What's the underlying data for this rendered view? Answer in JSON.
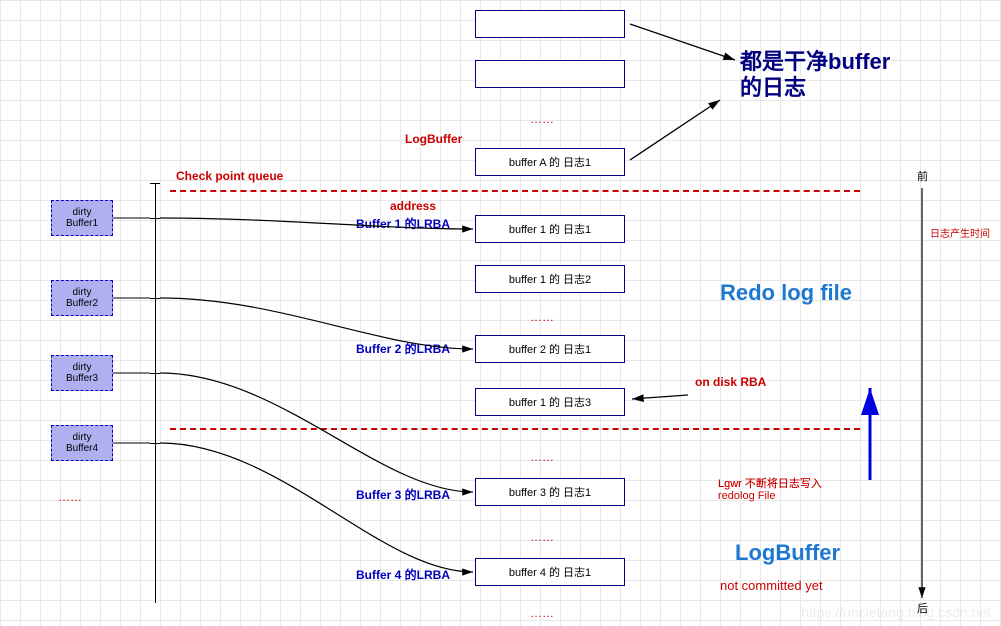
{
  "dirty_buffers": [
    {
      "line1": "dirty",
      "line2": "Buffer1"
    },
    {
      "line1": "dirty",
      "line2": "Buffer2"
    },
    {
      "line1": "dirty",
      "line2": "Buffer3"
    },
    {
      "line1": "dirty",
      "line2": "Buffer4"
    }
  ],
  "ellipsis_left": "……",
  "check_point_queue": "Check point queue",
  "log_buffer_label_top": "LogBuffer",
  "address_label": "address",
  "lrba": [
    "Buffer 1 的LRBA",
    "Buffer 2 的LRBA",
    "Buffer 3 的LRBA",
    "Buffer 4 的LRBA"
  ],
  "on_disk_rba": "on disk RBA",
  "clean_buffer_line1": "都是干净buffer",
  "clean_buffer_line2": "的日志",
  "redo_log_file": "Redo log file",
  "lgwr_line1": "Lgwr 不断将日志写入",
  "lgwr_line2": "redolog File",
  "log_buffer_big": "LogBuffer",
  "not_committed": "not committed yet",
  "time_label": "日志产生时间",
  "time_top": "前",
  "time_bottom": "后",
  "ellipsis": "……",
  "log_boxes": {
    "top1": "",
    "top2": "",
    "bufferA": "buffer A 的 日志1",
    "b1_1": "buffer 1 的 日志1",
    "b1_2": "buffer 1 的 日志2",
    "b2_1": "buffer 2 的 日志1",
    "b1_3": "buffer 1 的 日志3",
    "b3_1": "buffer 3 的 日志1",
    "b4_1": "buffer 4 的 日志1"
  },
  "watermark": "https://uncletang.blog.csdn.net"
}
